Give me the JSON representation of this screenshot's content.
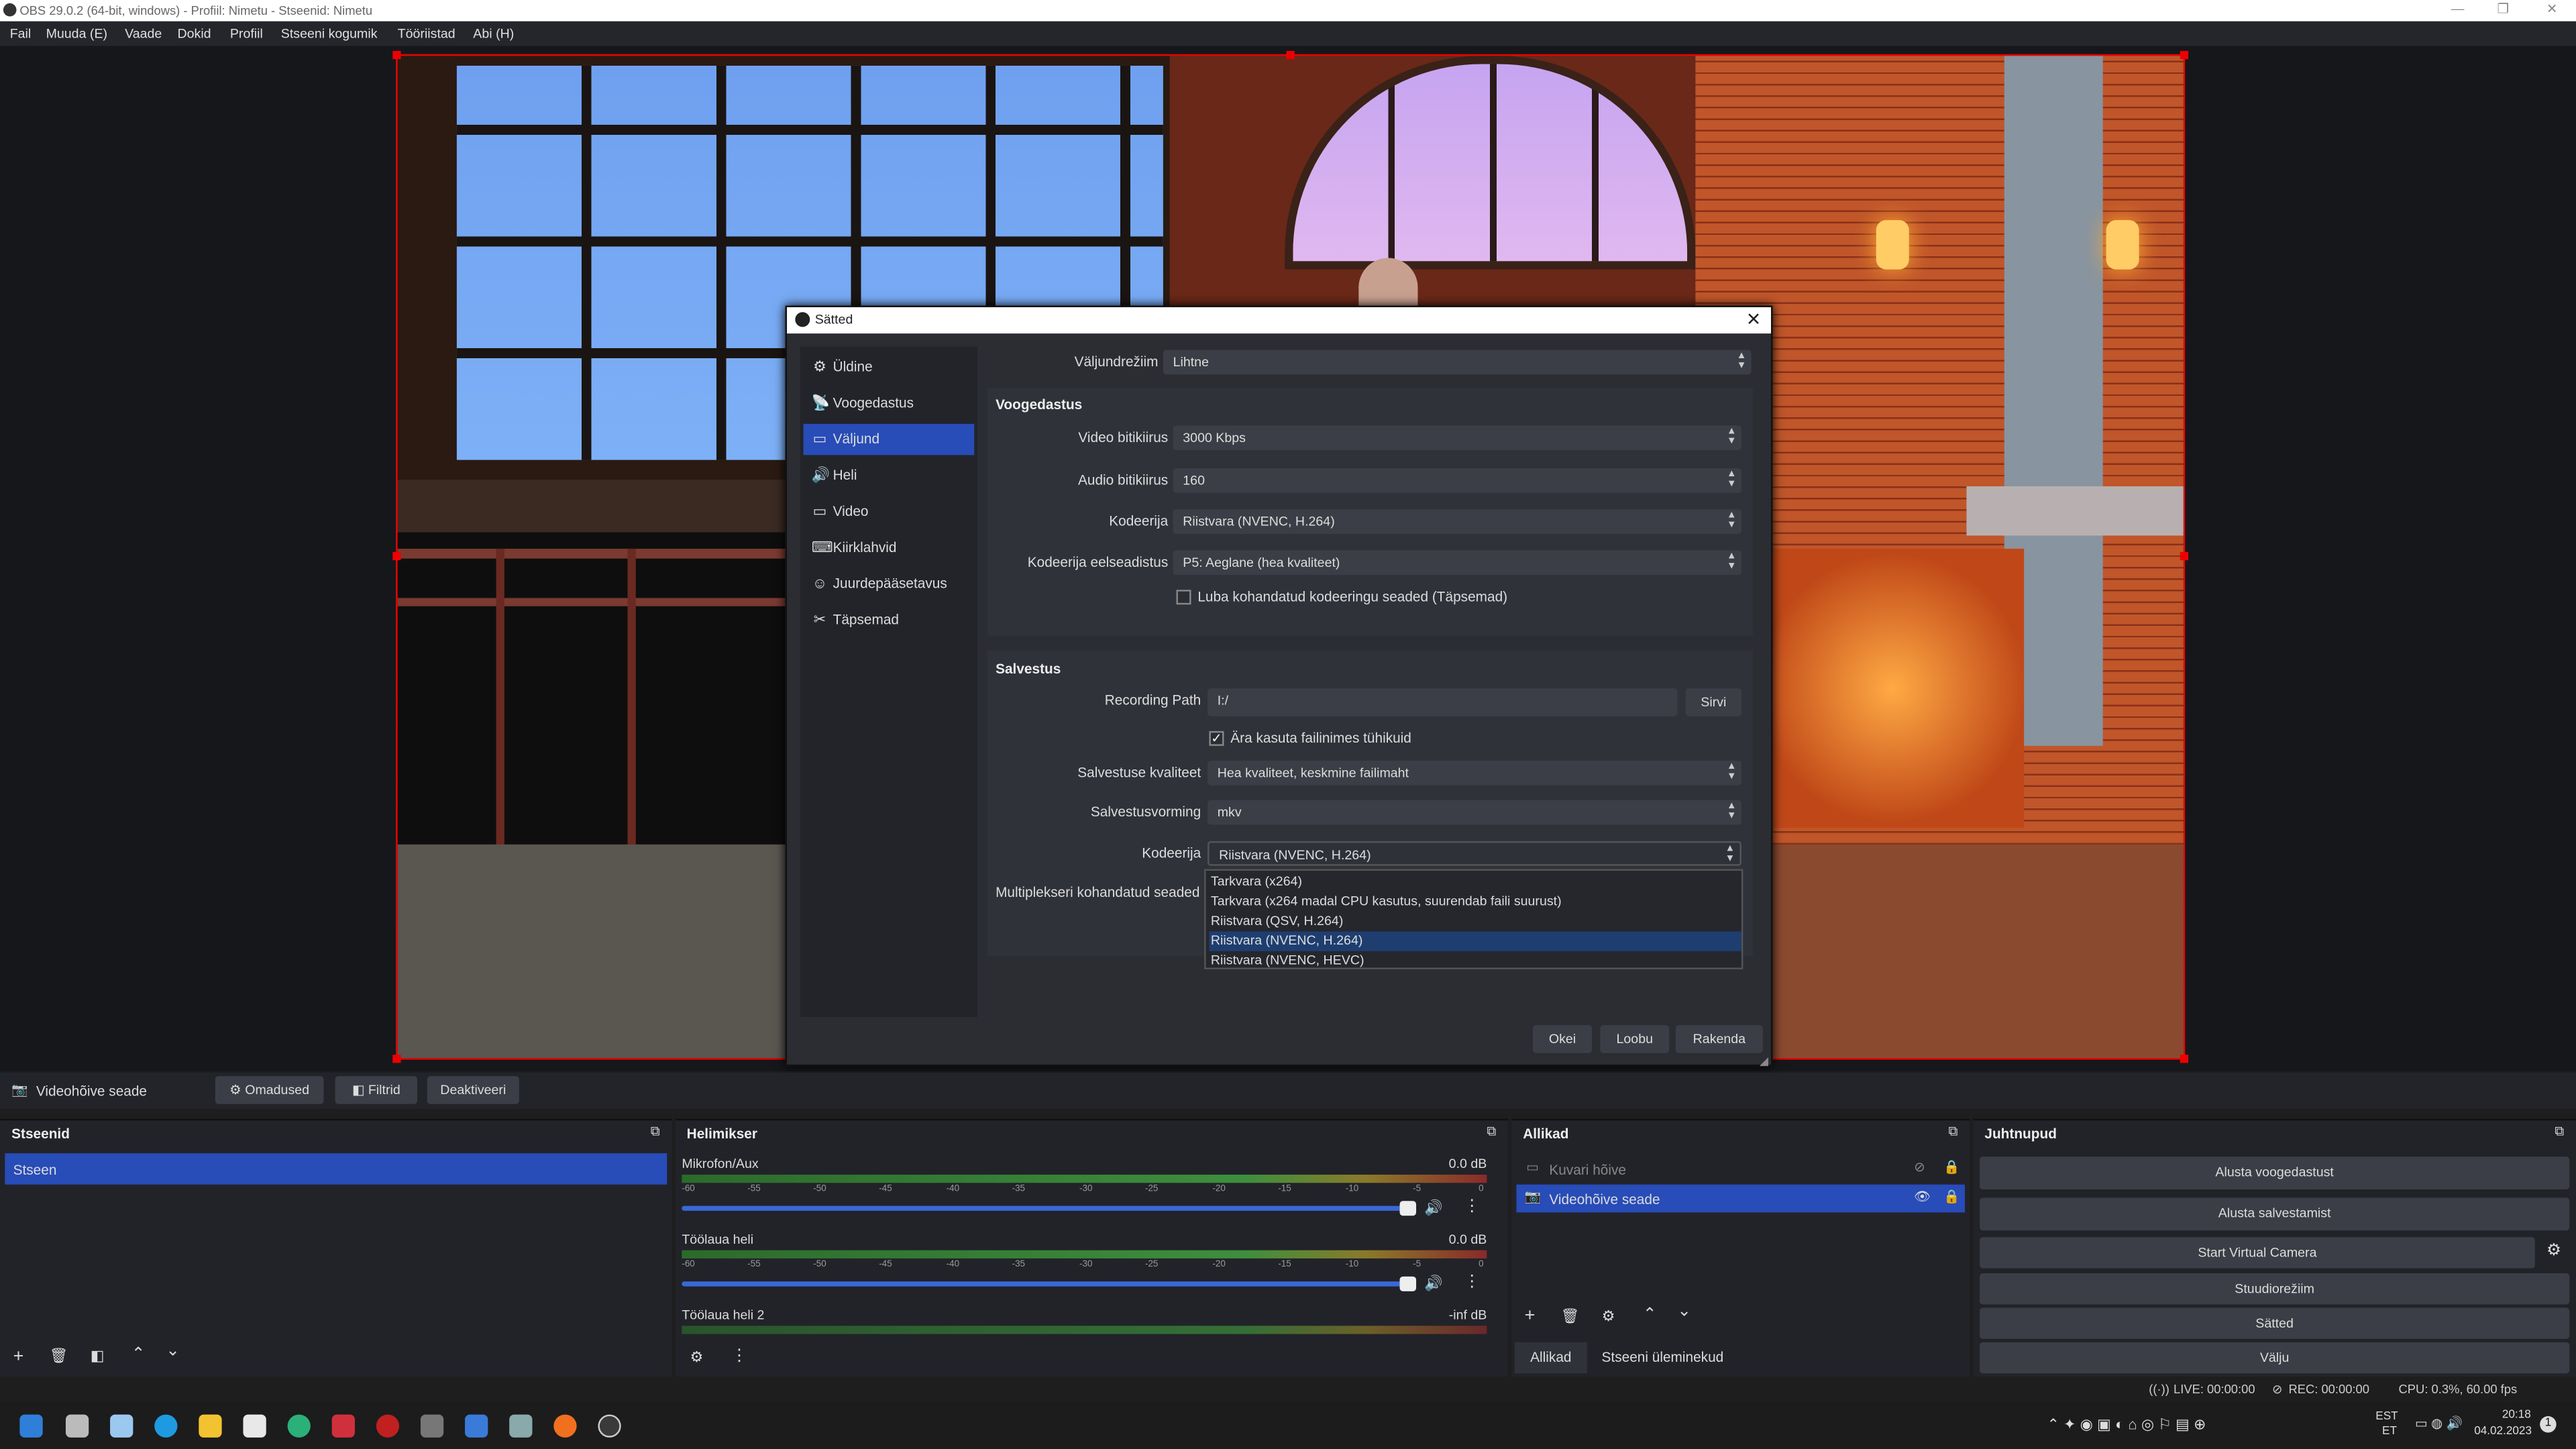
{
  "window": {
    "title": "OBS 29.0.2 (64-bit, windows) - Profiil: Nimetu - Stseenid: Nimetu"
  },
  "menu": [
    "Fail",
    "Muuda (E)",
    "Vaade",
    "Dokid",
    "Profiil",
    "Stseeni kogumik",
    "Tööriistad",
    "Abi (H)"
  ],
  "dialog": {
    "title": "Sätted",
    "nav": [
      {
        "icon": "gear-icon",
        "glyph": "⚙",
        "label": "Üldine"
      },
      {
        "icon": "broadcast-icon",
        "glyph": "📡",
        "label": "Voogedastus"
      },
      {
        "icon": "monitor-output-icon",
        "glyph": "▭",
        "label": "Väljund"
      },
      {
        "icon": "speaker-icon",
        "glyph": "🔊",
        "label": "Heli"
      },
      {
        "icon": "monitor-icon",
        "glyph": "▭",
        "label": "Video"
      },
      {
        "icon": "keyboard-icon",
        "glyph": "⌨",
        "label": "Kiirklahvid"
      },
      {
        "icon": "accessibility-icon",
        "glyph": "☺",
        "label": "Juurdepääsetavus"
      },
      {
        "icon": "tools-icon",
        "glyph": "✂",
        "label": "Täpsemad"
      }
    ],
    "output_mode": {
      "label": "Väljundrežiim",
      "value": "Lihtne"
    },
    "streaming": {
      "title": "Voogedastus",
      "video_bitrate": {
        "label": "Video bitikiirus",
        "value": "3000 Kbps"
      },
      "audio_bitrate": {
        "label": "Audio bitikiirus",
        "value": "160"
      },
      "encoder": {
        "label": "Kodeerija",
        "value": "Riistvara (NVENC, H.264)"
      },
      "preset": {
        "label": "Kodeerija eelseadistus",
        "value": "P5: Aeglane (hea kvaliteet)"
      },
      "custom": {
        "label": "Luba kohandatud kodeeringu seaded (Täpsemad)",
        "checked": false
      }
    },
    "recording": {
      "title": "Salvestus",
      "path": {
        "label": "Recording Path",
        "value": "I:/",
        "browse": "Sirvi"
      },
      "no_spaces": {
        "label": "Ära kasuta failinimes tühikuid",
        "checked": "✓"
      },
      "quality": {
        "label": "Salvestuse kvaliteet",
        "value": "Hea kvaliteet, keskmine failimaht"
      },
      "format": {
        "label": "Salvestusvorming",
        "value": "mkv"
      },
      "encoder": {
        "label": "Kodeerija",
        "value": "Riistvara (NVENC, H.264)"
      },
      "mux": {
        "label": "Multiplekseri kohandatud seaded"
      },
      "encoder_options": [
        "Tarkvara (x264)",
        "Tarkvara (x264 madal CPU kasutus, suurendab faili suurust)",
        "Riistvara (QSV, H.264)",
        "Riistvara (NVENC, H.264)",
        "Riistvara (NVENC, HEVC)"
      ]
    },
    "buttons": {
      "ok": "Okei",
      "cancel": "Loobu",
      "apply": "Rakenda"
    }
  },
  "source_bar": {
    "source": "Videohõive seade",
    "properties": "Omadused",
    "filters": "Filtrid",
    "deactivate": "Deaktiveeri"
  },
  "scenes": {
    "title": "Stseenid",
    "items": [
      "Stseen"
    ]
  },
  "mixer": {
    "title": "Helimikser",
    "ticks": [
      "-60",
      "-55",
      "-50",
      "-45",
      "-40",
      "-35",
      "-30",
      "-25",
      "-20",
      "-15",
      "-10",
      "-5",
      "0"
    ],
    "channels": [
      {
        "name": "Mikrofon/Aux",
        "db": "0.0 dB"
      },
      {
        "name": "Töölaua heli",
        "db": "0.0 dB"
      },
      {
        "name": "Töölaua heli 2",
        "db": "-inf dB"
      }
    ]
  },
  "sources": {
    "title": "Allikad",
    "items": [
      {
        "name": "Kuvari hõive",
        "visible": false
      },
      {
        "name": "Videohõive seade",
        "visible": true
      }
    ],
    "tabs": [
      "Allikad",
      "Stseeni üleminekud"
    ]
  },
  "controls": {
    "title": "Juhtnupud",
    "buttons": [
      "Alusta voogedastust",
      "Alusta salvestamist",
      "Start Virtual Camera",
      "Stuudiorežiim",
      "Sätted",
      "Välju"
    ]
  },
  "status": {
    "live": "LIVE: 00:00:00",
    "rec": "REC: 00:00:00",
    "cpu": "CPU: 0.3%, 60.00 fps"
  },
  "taskbar": {
    "lang1": "EST",
    "lang2": "ET",
    "time": "20:18",
    "date": "04.02.2023",
    "badge": "1"
  }
}
